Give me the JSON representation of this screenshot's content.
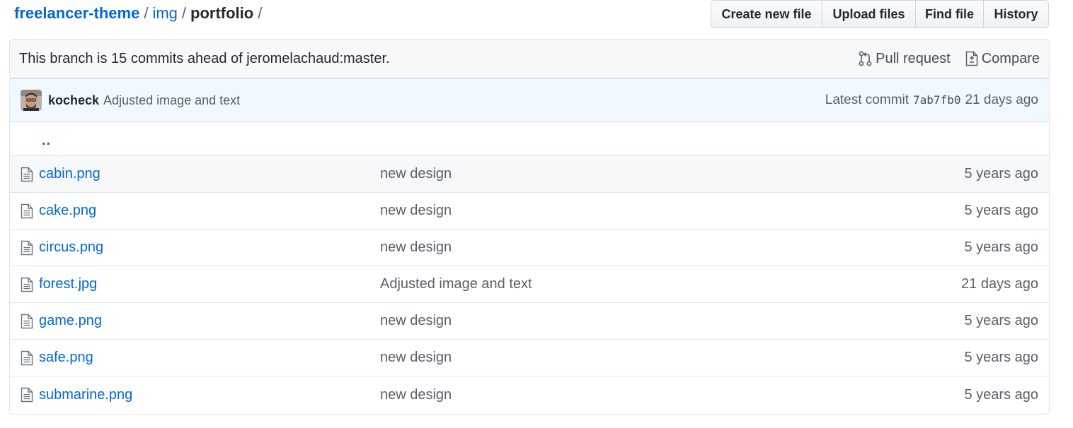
{
  "breadcrumb": {
    "repo": "freelancer-theme",
    "folder": "img",
    "current": "portfolio",
    "separator": "/"
  },
  "toolbar": {
    "create_new_file": "Create new file",
    "upload_files": "Upload files",
    "find_file": "Find file",
    "history": "History"
  },
  "branch_info": {
    "text": "This branch is 15 commits ahead of jeromelachaud:master.",
    "pull_request": "Pull request",
    "compare": "Compare",
    "pull_request_icon": "git-pull-request-icon",
    "compare_icon": "diff-icon"
  },
  "latest_commit": {
    "author": "kocheck",
    "message": "Adjusted image and text",
    "label": "Latest commit",
    "sha": "7ab7fb0",
    "age": "21 days ago"
  },
  "parent_link": "..",
  "files": [
    {
      "name": "cabin.png",
      "commit": "new design",
      "age": "5 years ago"
    },
    {
      "name": "cake.png",
      "commit": "new design",
      "age": "5 years ago"
    },
    {
      "name": "circus.png",
      "commit": "new design",
      "age": "5 years ago"
    },
    {
      "name": "forest.jpg",
      "commit": "Adjusted image and text",
      "age": "21 days ago"
    },
    {
      "name": "game.png",
      "commit": "new design",
      "age": "5 years ago"
    },
    {
      "name": "safe.png",
      "commit": "new design",
      "age": "5 years ago"
    },
    {
      "name": "submarine.png",
      "commit": "new design",
      "age": "5 years ago"
    }
  ],
  "colors": {
    "link": "#0366d6",
    "muted": "#586069",
    "commit_bar_bg": "#f1f8ff",
    "branch_bar_bg": "#f6f8fa"
  }
}
